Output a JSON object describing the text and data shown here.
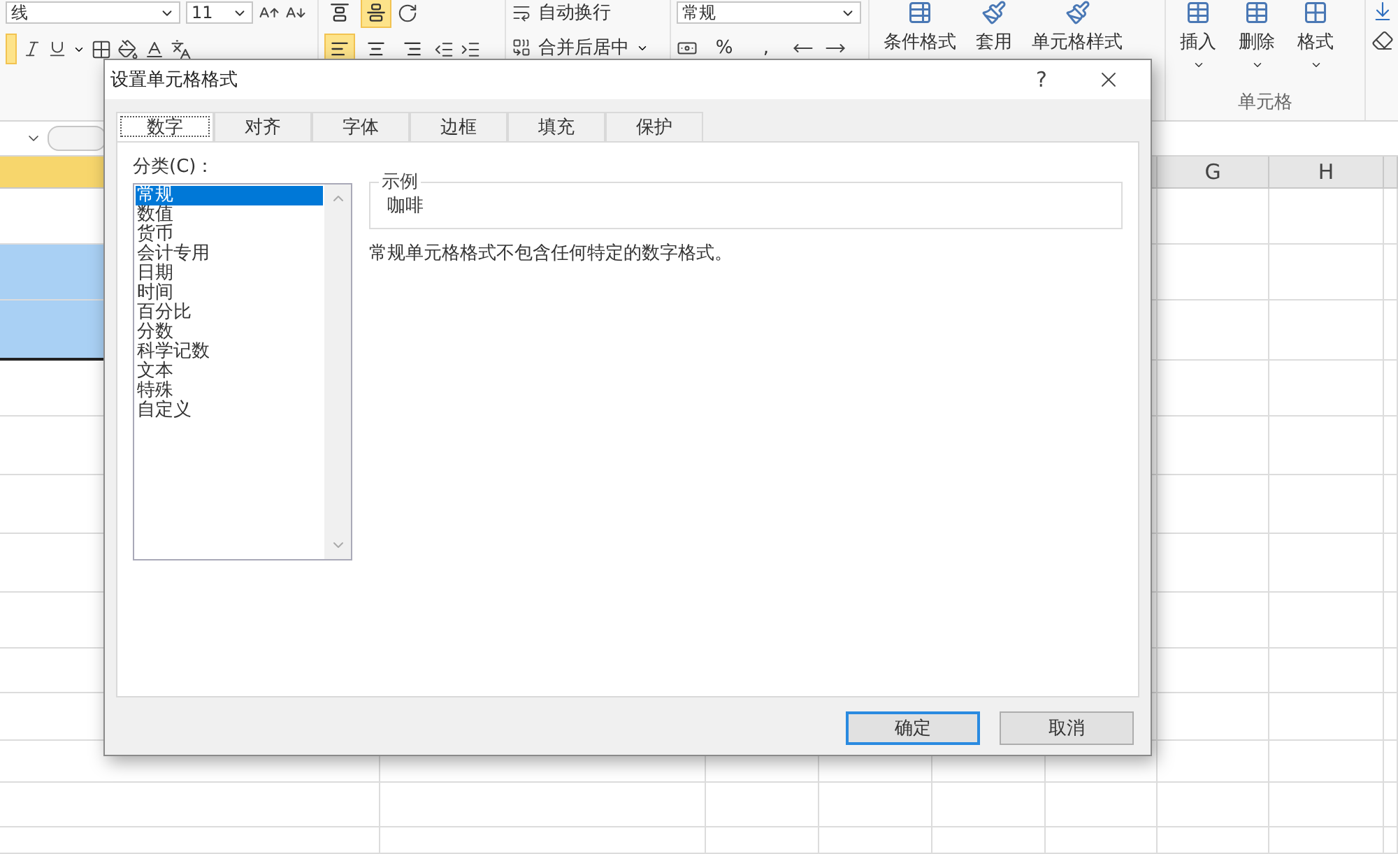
{
  "ribbon": {
    "font_name": "线",
    "font_size": "11",
    "bold": {
      "selected": true
    },
    "vertical_align": [
      {
        "selected": false
      },
      {
        "selected": true
      }
    ],
    "horizontal_align": [
      {
        "selected": true
      },
      {
        "selected": false
      },
      {
        "selected": false
      }
    ],
    "wrap_text": "自动换行",
    "merge_center": "合并后居中",
    "number_format": "常规",
    "percent": "%",
    "comma": ",",
    "style_buttons": [
      {
        "label": "条件格式"
      },
      {
        "label": "套用"
      },
      {
        "label": "单元格样式"
      }
    ],
    "cell_buttons": [
      {
        "label": "插入"
      },
      {
        "label": "删除"
      },
      {
        "label": "格式"
      }
    ],
    "cell_group_label": "单元格"
  },
  "sheet": {
    "columns": [
      {
        "selected": true
      },
      {
        "label": "G",
        "selected": false
      },
      {
        "label": "H",
        "selected": false
      },
      {
        "selected": false
      }
    ],
    "rows": [
      {
        "selected": false
      },
      {
        "selected": true
      },
      {
        "selected": true
      },
      {
        "selected": false
      },
      {
        "selected": false
      },
      {
        "selected": false
      },
      {
        "selected": false
      },
      {
        "selected": false
      },
      {
        "selected": false
      },
      {
        "selected": false
      },
      {
        "selected": false
      },
      {
        "selected": false
      },
      {
        "selected": false
      }
    ]
  },
  "dialog": {
    "title": "设置单元格格式",
    "help": "?",
    "tabs": [
      {
        "label": "数字",
        "selected": true
      },
      {
        "label": "对齐",
        "selected": false
      },
      {
        "label": "字体",
        "selected": false
      },
      {
        "label": "边框",
        "selected": false
      },
      {
        "label": "填充",
        "selected": false
      },
      {
        "label": "保护",
        "selected": false
      }
    ],
    "category_label": "分类(C)：",
    "categories": [
      {
        "label": "常规",
        "selected": true
      },
      {
        "label": "数值",
        "selected": false
      },
      {
        "label": "货币",
        "selected": false
      },
      {
        "label": "会计专用",
        "selected": false
      },
      {
        "label": "日期",
        "selected": false
      },
      {
        "label": "时间",
        "selected": false
      },
      {
        "label": "百分比",
        "selected": false
      },
      {
        "label": "分数",
        "selected": false
      },
      {
        "label": "科学记数",
        "selected": false
      },
      {
        "label": "文本",
        "selected": false
      },
      {
        "label": "特殊",
        "selected": false
      },
      {
        "label": "自定义",
        "selected": false
      }
    ],
    "sample_label": "示例",
    "sample_value": "咖啡",
    "description": "常规单元格格式不包含任何特定的数字格式。",
    "buttons": [
      {
        "label": "确定",
        "default": true
      },
      {
        "label": "取消",
        "default": false
      }
    ]
  }
}
